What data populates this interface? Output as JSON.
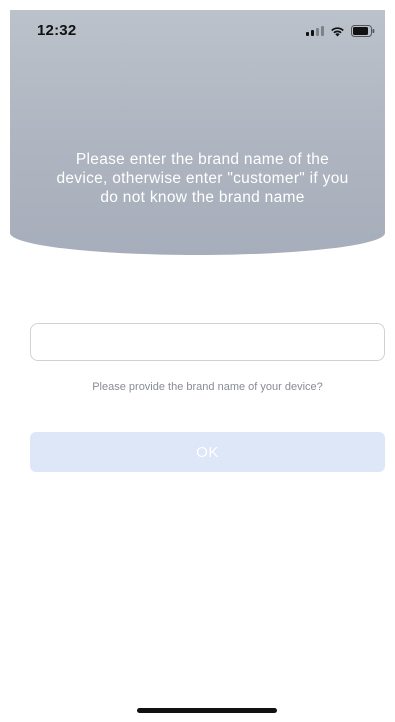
{
  "status_bar": {
    "time": "12:32",
    "signal_icon": "cellular-signal-icon",
    "wifi_icon": "wifi-icon",
    "battery_icon": "battery-icon"
  },
  "header": {
    "instruction": "Please enter the brand name of the device, otherwise enter \"customer\" if you do not know the brand name"
  },
  "form": {
    "brand_input_value": "",
    "brand_input_placeholder": "",
    "hint": "Please provide the brand name of your device?",
    "ok_label": "OK"
  },
  "colors": {
    "header_gray": "#aeb5c0",
    "button_disabled": "#dde7f8",
    "hint_text": "#888c93"
  }
}
